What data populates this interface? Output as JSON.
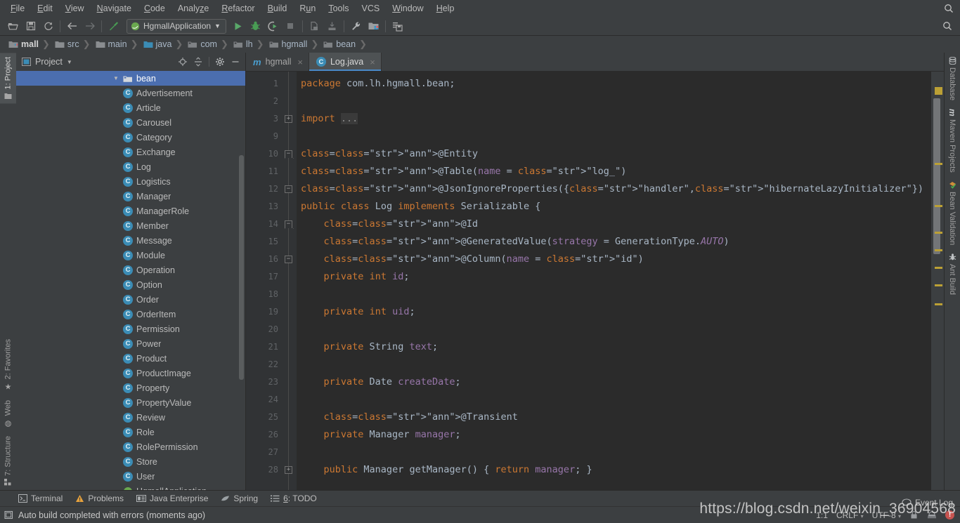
{
  "menubar": {
    "items": [
      {
        "label": "File",
        "mnemonic": "F"
      },
      {
        "label": "Edit",
        "mnemonic": "E"
      },
      {
        "label": "View",
        "mnemonic": "V"
      },
      {
        "label": "Navigate",
        "mnemonic": "N"
      },
      {
        "label": "Code",
        "mnemonic": "C"
      },
      {
        "label": "Analyze",
        "mnemonic": "z"
      },
      {
        "label": "Refactor",
        "mnemonic": "R"
      },
      {
        "label": "Build",
        "mnemonic": "B"
      },
      {
        "label": "Run",
        "mnemonic": "u"
      },
      {
        "label": "Tools",
        "mnemonic": "T"
      },
      {
        "label": "VCS",
        "mnemonic": ""
      },
      {
        "label": "Window",
        "mnemonic": "W"
      },
      {
        "label": "Help",
        "mnemonic": "H"
      }
    ],
    "search_icon": "search-icon"
  },
  "toolbar": {
    "icons": [
      "open-folder-icon",
      "save-icon",
      "sync-refresh-icon",
      "back-arrow-icon",
      "forward-arrow-icon",
      "build-hammer-icon"
    ],
    "run_config": {
      "label": "HgmallApplication",
      "icon": "spring-boot-run-config-icon",
      "chevron": "chevron-down-icon"
    },
    "run_icons": [
      "run-icon",
      "debug-icon",
      "run-with-coverage-icon",
      "stop-icon",
      "update-project-icon",
      "commit-icon",
      "settings-wrench-icon",
      "project-structure-icon",
      "save-all-icon"
    ],
    "search_icon": "search-icon"
  },
  "breadcrumbs": [
    {
      "label": "mall",
      "icon": "module-icon"
    },
    {
      "label": "src",
      "icon": "folder-icon"
    },
    {
      "label": "main",
      "icon": "folder-icon"
    },
    {
      "label": "java",
      "icon": "source-folder-icon"
    },
    {
      "label": "com",
      "icon": "package-icon"
    },
    {
      "label": "lh",
      "icon": "package-icon"
    },
    {
      "label": "hgmall",
      "icon": "package-icon"
    },
    {
      "label": "bean",
      "icon": "package-icon"
    }
  ],
  "left_strip": [
    {
      "label": "1: Project",
      "mnemonic": "1",
      "icon": "project-panel-icon",
      "active": true
    },
    {
      "label": "2: Favorites",
      "mnemonic": "2",
      "icon": "star-icon",
      "active": false
    },
    {
      "label": "Web",
      "mnemonic": "",
      "icon": "web-globe-icon",
      "active": false
    },
    {
      "label": "7: Structure",
      "mnemonic": "7",
      "icon": "structure-icon",
      "active": false
    }
  ],
  "right_strip": [
    {
      "label": "Database",
      "icon": "database-icon"
    },
    {
      "label": "Maven Projects",
      "icon": "maven-icon"
    },
    {
      "label": "Bean Validation",
      "icon": "bean-validation-icon"
    },
    {
      "label": "Ant Build",
      "icon": "ant-build-icon"
    }
  ],
  "project_panel": {
    "title": "Project",
    "chevron": "chevron-down-icon",
    "tools": [
      "locate-target-icon",
      "collapse-all-icon",
      "settings-gear-icon",
      "hide-panel-icon"
    ],
    "tree": [
      {
        "label": "bean",
        "type": "folder",
        "selected": true,
        "expanded": true
      },
      {
        "label": "Advertisement",
        "type": "class"
      },
      {
        "label": "Article",
        "type": "class"
      },
      {
        "label": "Carousel",
        "type": "class"
      },
      {
        "label": "Category",
        "type": "class"
      },
      {
        "label": "Exchange",
        "type": "class"
      },
      {
        "label": "Log",
        "type": "class"
      },
      {
        "label": "Logistics",
        "type": "class"
      },
      {
        "label": "Manager",
        "type": "class"
      },
      {
        "label": "ManagerRole",
        "type": "class"
      },
      {
        "label": "Member",
        "type": "class"
      },
      {
        "label": "Message",
        "type": "class"
      },
      {
        "label": "Module",
        "type": "class"
      },
      {
        "label": "Operation",
        "type": "class"
      },
      {
        "label": "Option",
        "type": "class"
      },
      {
        "label": "Order",
        "type": "class"
      },
      {
        "label": "OrderItem",
        "type": "class"
      },
      {
        "label": "Permission",
        "type": "class"
      },
      {
        "label": "Power",
        "type": "class"
      },
      {
        "label": "Product",
        "type": "class"
      },
      {
        "label": "ProductImage",
        "type": "class"
      },
      {
        "label": "Property",
        "type": "class"
      },
      {
        "label": "PropertyValue",
        "type": "class"
      },
      {
        "label": "Review",
        "type": "class"
      },
      {
        "label": "Role",
        "type": "class"
      },
      {
        "label": "RolePermission",
        "type": "class"
      },
      {
        "label": "Store",
        "type": "class"
      },
      {
        "label": "User",
        "type": "class"
      },
      {
        "label": "HgmallApplication",
        "type": "spring-class"
      }
    ]
  },
  "editor": {
    "tabs": [
      {
        "label": "hgmall",
        "icon": "maven-pom-icon",
        "active": false,
        "close": "×"
      },
      {
        "label": "Log.java",
        "icon": "java-class-icon",
        "active": true,
        "close": "×"
      }
    ],
    "lines": [
      {
        "n": "1",
        "fold": "",
        "text": "package com.lh.hgmall.bean;"
      },
      {
        "n": "2",
        "fold": "",
        "text": ""
      },
      {
        "n": "3",
        "fold": "plus",
        "text": "import ..."
      },
      {
        "n": "9",
        "fold": "",
        "text": ""
      },
      {
        "n": "10",
        "fold": "tri",
        "text": "@Entity"
      },
      {
        "n": "11",
        "fold": "",
        "text": "@Table(name = \"log_\")"
      },
      {
        "n": "12",
        "fold": "minus",
        "text": "@JsonIgnoreProperties({\"handler\",\"hibernateLazyInitializer\"})"
      },
      {
        "n": "13",
        "fold": "",
        "text": "public class Log implements Serializable {"
      },
      {
        "n": "14",
        "fold": "tri",
        "text": "    @Id"
      },
      {
        "n": "15",
        "fold": "",
        "text": "    @GeneratedValue(strategy = GenerationType.AUTO)"
      },
      {
        "n": "16",
        "fold": "minus",
        "text": "    @Column(name = \"id\")"
      },
      {
        "n": "17",
        "fold": "",
        "text": "    private int id;"
      },
      {
        "n": "18",
        "fold": "",
        "text": ""
      },
      {
        "n": "19",
        "fold": "",
        "text": "    private int uid;"
      },
      {
        "n": "20",
        "fold": "",
        "text": ""
      },
      {
        "n": "21",
        "fold": "",
        "text": "    private String text;"
      },
      {
        "n": "22",
        "fold": "",
        "text": ""
      },
      {
        "n": "23",
        "fold": "",
        "text": "    private Date createDate;"
      },
      {
        "n": "24",
        "fold": "",
        "text": ""
      },
      {
        "n": "25",
        "fold": "",
        "text": "    @Transient"
      },
      {
        "n": "26",
        "fold": "",
        "text": "    private Manager manager;"
      },
      {
        "n": "27",
        "fold": "",
        "text": ""
      },
      {
        "n": "28",
        "fold": "plus",
        "text": "    public Manager getManager() { return manager; }"
      }
    ]
  },
  "tool_windows": [
    {
      "label": "Terminal",
      "mnemonic": "",
      "icon": "terminal-icon"
    },
    {
      "label": "Problems",
      "mnemonic": "",
      "icon": "warning-triangle-icon"
    },
    {
      "label": "Java Enterprise",
      "mnemonic": "",
      "icon": "java-enterprise-icon"
    },
    {
      "label": "Spring",
      "mnemonic": "",
      "icon": "spring-leaf-icon"
    },
    {
      "label": "6: TODO",
      "mnemonic": "6",
      "icon": "todo-list-icon"
    }
  ],
  "statusbar": {
    "message": "Auto build completed with errors (moments ago)",
    "message_icon": "build-status-icon",
    "caret_position": "1:1",
    "line_separator": "CRLF",
    "encoding": "UTF-8",
    "lock_icon": "read-only-lock-icon",
    "inspection_icon": "inspection-hector-icon",
    "error_badge": "!",
    "event_log": {
      "label": "Event Log",
      "icon": "event-log-icon"
    }
  },
  "watermark": "https://blog.csdn.net/weixin_36904568",
  "colors": {
    "accent": "#4b6eaf",
    "panel_bg": "#3c3f41",
    "editor_bg": "#2b2b2b",
    "gutter_bg": "#313335",
    "tab_active": "#4e5254",
    "tab_underline": "#4a88c7",
    "class_icon": "#3b8cb5",
    "annotation": "#bbb529",
    "keyword": "#cc7832",
    "string": "#6a8759",
    "field": "#9876aa",
    "marker": "#bba035",
    "error": "#c75450"
  }
}
